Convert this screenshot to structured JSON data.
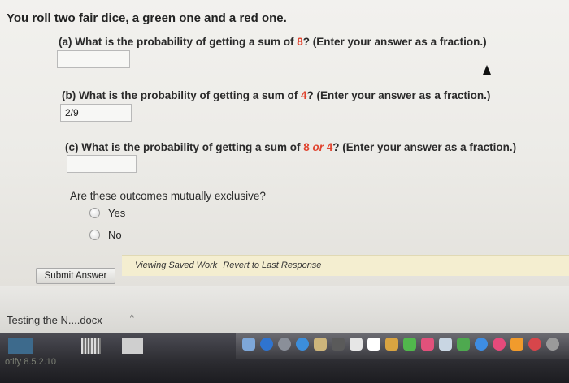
{
  "problem": {
    "intro": "You roll two fair dice, a green one and a red one.",
    "qa": {
      "prefix": "(a) What is the probability of getting a sum of ",
      "value": "8",
      "suffix": "? (Enter your answer as a fraction.)",
      "answer": ""
    },
    "qb": {
      "prefix": "(b) What is the probability of getting a sum of ",
      "value": "4",
      "suffix": "? (Enter your answer as a fraction.)",
      "answer": "2/9"
    },
    "qc": {
      "prefix": "(c) What is the probability of getting a sum of ",
      "value1": "8",
      "mid": " or ",
      "value2": "4",
      "suffix": "? (Enter your answer as a fraction.)",
      "answer": ""
    },
    "mutual": {
      "question": "Are these outcomes mutually exclusive?",
      "yes": "Yes",
      "no": "No"
    }
  },
  "footer": {
    "submit_label": "Submit Answer",
    "viewing_saved": "Viewing Saved Work",
    "revert": "Revert to Last Response"
  },
  "downloads": {
    "item": "Testing the N....docx",
    "caret": "^"
  },
  "taskbar": {
    "bottom_text": "otify 8.5.2.10"
  },
  "colors": {
    "highlight": "#e0442f"
  }
}
